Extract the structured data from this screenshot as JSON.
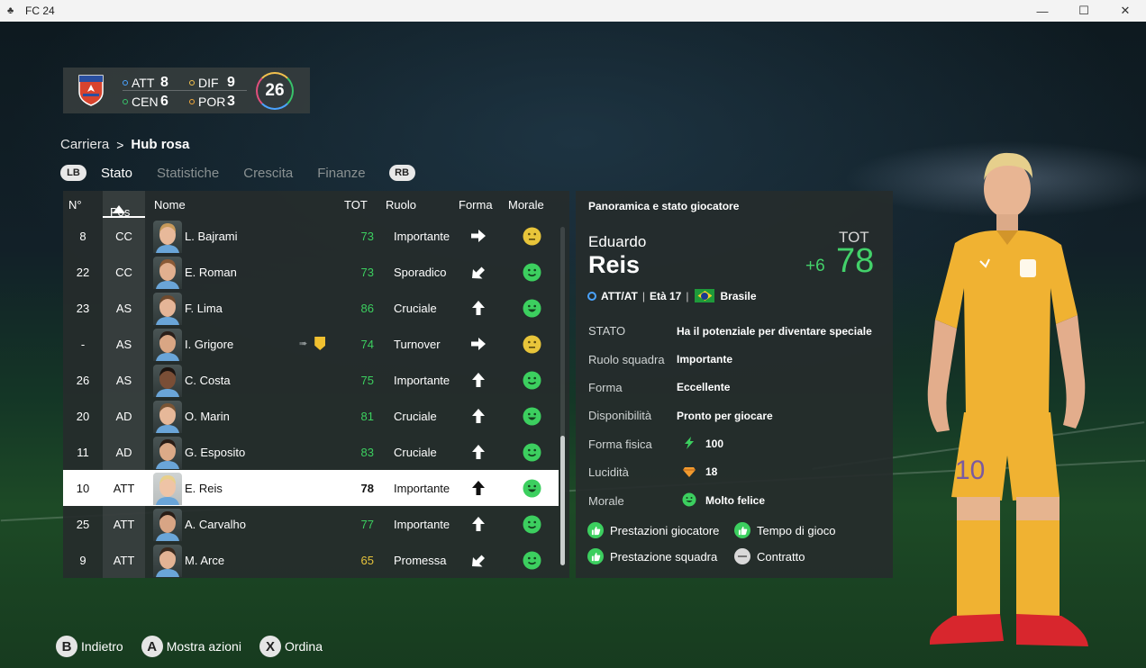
{
  "window": {
    "title": "FC 24",
    "minimize_glyph": "—",
    "maximize_glyph": "☐",
    "close_glyph": "✕"
  },
  "club": {
    "counts": [
      {
        "label": "ATT",
        "value": "8",
        "dot_color": "#4aa3ff"
      },
      {
        "label": "DIF",
        "value": "9",
        "dot_color": "#f2c14e"
      },
      {
        "label": "CEN",
        "value": "6",
        "dot_color": "#38c36a"
      },
      {
        "label": "POR",
        "value": "3",
        "dot_color": "#f2a93b"
      }
    ],
    "total": "26"
  },
  "breadcrumb": {
    "parent": "Carriera",
    "separator": ">",
    "current": "Hub rosa"
  },
  "tabs": {
    "left_bumper": "LB",
    "right_bumper": "RB",
    "items": [
      "Stato",
      "Statistiche",
      "Crescita",
      "Finanze"
    ],
    "active": "Stato"
  },
  "table": {
    "headers": {
      "num": "N°",
      "pos": "Pos",
      "name": "Nome",
      "tot": "TOT",
      "role": "Ruolo",
      "form": "Forma",
      "morale": "Morale"
    },
    "rows": [
      {
        "num": "8",
        "pos": "CC",
        "name": "L. Bajrami",
        "tot": "73",
        "tot_color": "green",
        "role": "Importante",
        "form": "right",
        "morale": "neutral",
        "skin": "#e8b99a",
        "hair": "#c79a5a"
      },
      {
        "num": "22",
        "pos": "CC",
        "name": "E. Roman",
        "tot": "73",
        "tot_color": "green",
        "role": "Sporadico",
        "form": "down-left",
        "morale": "happy",
        "skin": "#e2b08f",
        "hair": "#8a5a36"
      },
      {
        "num": "23",
        "pos": "AS",
        "name": "F. Lima",
        "tot": "86",
        "tot_color": "green",
        "role": "Cruciale",
        "form": "up",
        "morale": "very-happy",
        "skin": "#e5b597",
        "hair": "#6e4a2e"
      },
      {
        "num": "-",
        "pos": "AS",
        "name": "I. Grigore",
        "tot": "74",
        "tot_color": "green",
        "role": "Turnover",
        "form": "right",
        "morale": "neutral",
        "skin": "#d9a684",
        "hair": "#2a1f1a",
        "loan": true
      },
      {
        "num": "26",
        "pos": "AS",
        "name": "C. Costa",
        "tot": "75",
        "tot_color": "green",
        "role": "Importante",
        "form": "up",
        "morale": "happy",
        "skin": "#7a4e36",
        "hair": "#1c1410"
      },
      {
        "num": "20",
        "pos": "AD",
        "name": "O. Marin",
        "tot": "81",
        "tot_color": "green",
        "role": "Cruciale",
        "form": "up",
        "morale": "very-happy",
        "skin": "#e6b899",
        "hair": "#7a5535"
      },
      {
        "num": "11",
        "pos": "AD",
        "name": "G. Esposito",
        "tot": "83",
        "tot_color": "green",
        "role": "Cruciale",
        "form": "up",
        "morale": "happy",
        "skin": "#dcaa88",
        "hair": "#2b1d16"
      },
      {
        "num": "10",
        "pos": "ATT",
        "name": "E. Reis",
        "tot": "78",
        "tot_color": "green",
        "role": "Importante",
        "form": "up",
        "morale": "very-happy",
        "skin": "#efc4a6",
        "hair": "#e8cf8a",
        "selected": true
      },
      {
        "num": "25",
        "pos": "ATT",
        "name": "A. Carvalho",
        "tot": "77",
        "tot_color": "green",
        "role": "Importante",
        "form": "up",
        "morale": "happy",
        "skin": "#d8a585",
        "hair": "#2a1e17"
      },
      {
        "num": "9",
        "pos": "ATT",
        "name": "M. Arce",
        "tot": "65",
        "tot_color": "yellow",
        "role": "Promessa",
        "form": "down-left",
        "morale": "happy",
        "skin": "#e3b394",
        "hair": "#3b2a1e"
      }
    ]
  },
  "detail": {
    "panel_title": "Panoramica e stato giocatore",
    "first_name": "Eduardo",
    "last_name": "Reis",
    "tot_label": "TOT",
    "tot_value": "78",
    "tot_boost": "+6",
    "position": "ATT/AT",
    "age": "Età 17",
    "nation": "Brasile",
    "stats": [
      {
        "label": "STATO",
        "value": "Ha il potenziale per diventare speciale"
      },
      {
        "label": "Ruolo squadra",
        "value": "Importante"
      },
      {
        "label": "Forma",
        "value": "Eccellente"
      },
      {
        "label": "Disponibilità",
        "value": "Pronto per giocare"
      }
    ],
    "fitness": {
      "label": "Forma fisica",
      "value": "100",
      "icon": "lightning-icon",
      "color": "#3ccf5f"
    },
    "sharpness": {
      "label": "Lucidità",
      "value": "18",
      "icon": "diamond-icon",
      "color": "#f29a2e"
    },
    "morale": {
      "label": "Morale",
      "value": "Molto felice",
      "icon": "very-happy-face-icon",
      "color": "#3ccf5f"
    },
    "factors": [
      {
        "label": "Prestazioni giocatore",
        "status": "positive"
      },
      {
        "label": "Tempo di gioco",
        "status": "positive"
      },
      {
        "label": "Prestazione squadra",
        "status": "positive"
      },
      {
        "label": "Contratto",
        "status": "neutral"
      }
    ]
  },
  "player_render": {
    "shirt_number": "10",
    "kit_color": "#f0b232"
  },
  "footer": [
    {
      "button": "B",
      "label": "Indietro"
    },
    {
      "button": "A",
      "label": "Mostra azioni"
    },
    {
      "button": "X",
      "label": "Ordina"
    }
  ],
  "colors": {
    "accent_green": "#43d16a",
    "rating_yellow": "#e6c33c",
    "selection": "#ffffff"
  }
}
